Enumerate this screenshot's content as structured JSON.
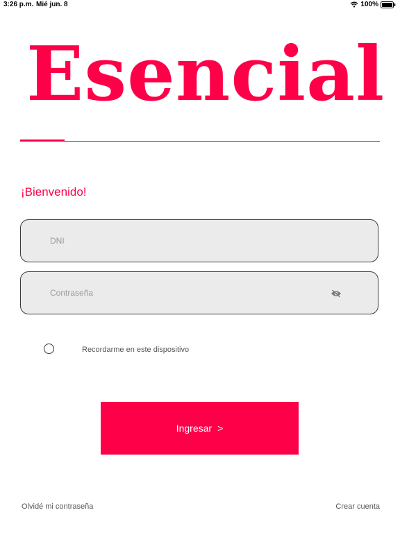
{
  "status_bar": {
    "time": "3:26 p.m.",
    "date": "Mié jun. 8",
    "battery": "100%",
    "icons": [
      "wifi-icon",
      "battery-icon"
    ]
  },
  "brand": {
    "logo_text": "Esencial",
    "accent_color": "#fe0048"
  },
  "welcome": "¡Bienvenido!",
  "form": {
    "dni": {
      "placeholder": "DNI",
      "value": ""
    },
    "password": {
      "placeholder": "Contraseña",
      "value": "",
      "toggle_icon": "eye-slash-icon"
    },
    "remember_label": "Recordarme en este dispositivo",
    "remember_checked": false,
    "submit_label": "Ingresar",
    "submit_arrow": ">"
  },
  "footer": {
    "forgot_password": "Olvidé mi contraseña",
    "create_account": "Crear cuenta"
  }
}
